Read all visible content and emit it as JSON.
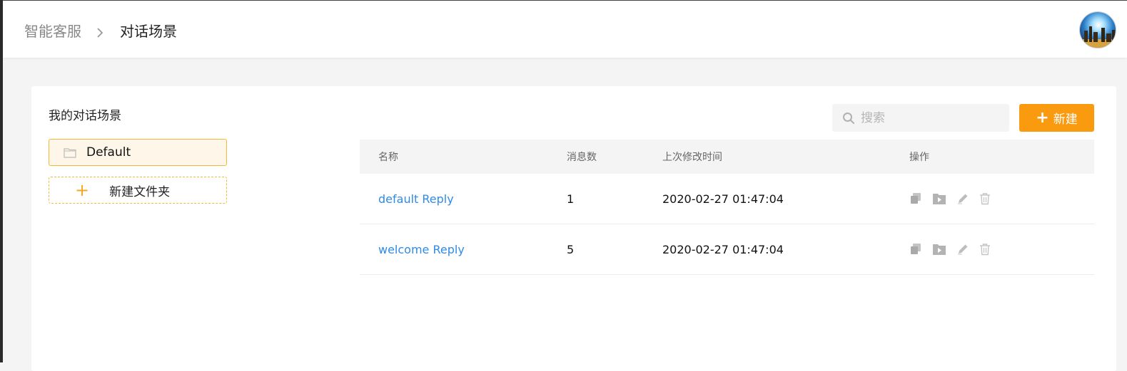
{
  "breadcrumb": {
    "root": "智能客服",
    "current": "对话场景"
  },
  "sidebar": {
    "title": "我的对话场景",
    "folders": [
      {
        "label": "Default",
        "selected": true
      }
    ],
    "new_folder_label": "新建文件夹"
  },
  "toolbar": {
    "search_placeholder": "搜索",
    "new_button_label": "新建"
  },
  "table": {
    "headers": {
      "name": "名称",
      "count": "消息数",
      "modified": "上次修改时间",
      "actions": "操作"
    },
    "rows": [
      {
        "name": "default Reply",
        "count": "1",
        "modified": "2020-02-27 01:47:04"
      },
      {
        "name": "welcome Reply",
        "count": "5",
        "modified": "2020-02-27 01:47:04"
      }
    ]
  },
  "colors": {
    "accent": "#fa9a0f",
    "link": "#2f8be6",
    "folder_border": "#f5b93a",
    "folder_bg": "#fdf6e9"
  },
  "icons": {
    "breadcrumb_separator": "chevron-right-icon",
    "folder": "folder-icon",
    "search": "search-icon",
    "row_actions": [
      "copy-icon",
      "move-icon",
      "edit-icon",
      "delete-icon"
    ]
  }
}
